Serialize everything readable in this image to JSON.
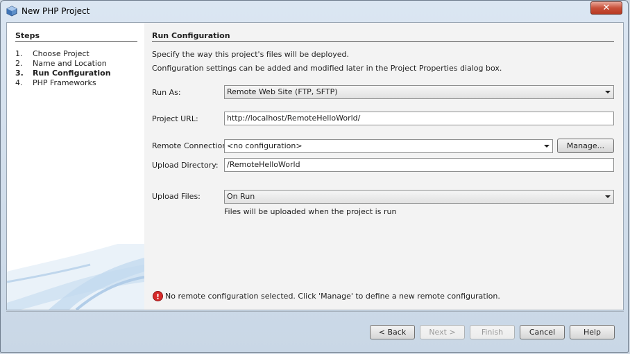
{
  "window": {
    "title": "New PHP Project",
    "close_glyph": "✕"
  },
  "steps": {
    "heading": "Steps",
    "items": [
      {
        "num": "1.",
        "label": "Choose Project",
        "current": false
      },
      {
        "num": "2.",
        "label": "Name and Location",
        "current": false
      },
      {
        "num": "3.",
        "label": "Run Configuration",
        "current": true
      },
      {
        "num": "4.",
        "label": "PHP Frameworks",
        "current": false
      }
    ]
  },
  "main": {
    "heading": "Run Configuration",
    "desc_line1": "Specify the way this project's files will be deployed.",
    "desc_line2": "Configuration settings can be added and modified later in the Project Properties dialog box.",
    "run_as": {
      "label": "Run As:",
      "value": "Remote Web Site (FTP, SFTP)"
    },
    "project_url": {
      "label": "Project URL:",
      "value": "http://localhost/RemoteHelloWorld/"
    },
    "remote_connection": {
      "label": "Remote Connection:",
      "value": "<no configuration>",
      "manage_label": "Manage..."
    },
    "upload_directory": {
      "label": "Upload Directory:",
      "value": "/RemoteHelloWorld"
    },
    "upload_files": {
      "label": "Upload Files:",
      "value": "On Run",
      "hint": "Files will be uploaded when the project is run"
    },
    "error": {
      "icon": "!",
      "message": "No remote configuration selected. Click 'Manage' to define a new remote configuration."
    }
  },
  "buttons": {
    "back": "< Back",
    "next": "Next >",
    "finish": "Finish",
    "cancel": "Cancel",
    "help": "Help"
  },
  "colors": {
    "error_red": "#d62a2a",
    "title_bar": "#dbe6f2"
  }
}
